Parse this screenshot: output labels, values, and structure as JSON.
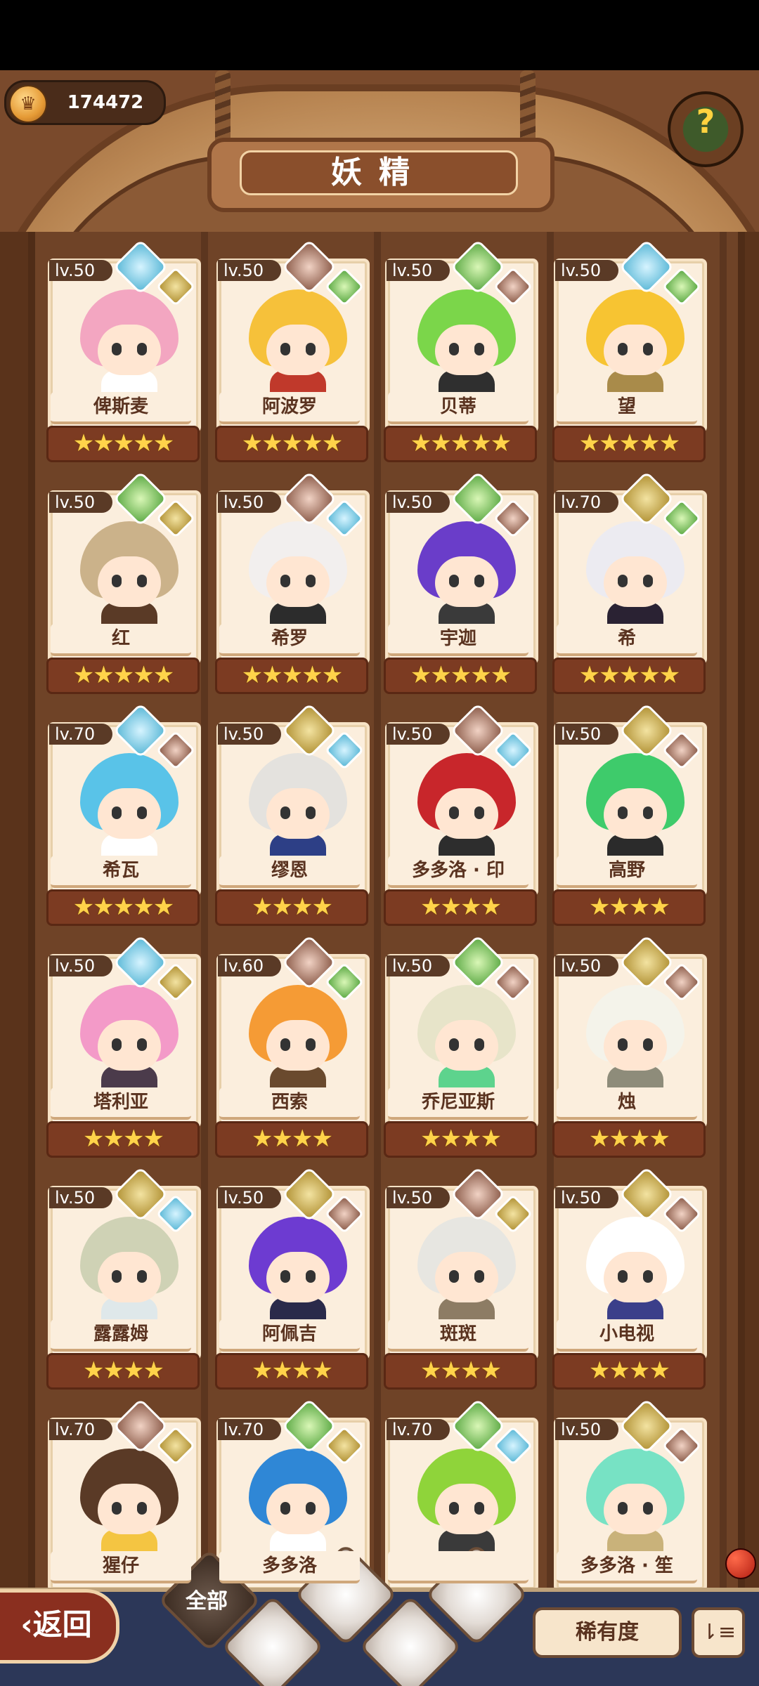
{
  "header": {
    "currency_value": "174472",
    "title": "妖精",
    "currency_icon": "coin-icon",
    "help_icon": "question-icon"
  },
  "cards": [
    {
      "level": "lv.50",
      "name": "俾斯麦",
      "stars": "★★★★★",
      "elements": [
        "water",
        "earth"
      ],
      "hair": "#f3a6c1",
      "outfit": "#ffffff"
    },
    {
      "level": "lv.50",
      "name": "阿波罗",
      "stars": "★★★★★",
      "elements": [
        "rock",
        "plant"
      ],
      "hair": "#f6c13a",
      "outfit": "#c0392b"
    },
    {
      "level": "lv.50",
      "name": "贝蒂",
      "stars": "★★★★★",
      "elements": [
        "plant",
        "rock"
      ],
      "hair": "#7bd64a",
      "outfit": "#2f2f2f"
    },
    {
      "level": "lv.50",
      "name": "望",
      "stars": "★★★★★",
      "elements": [
        "water",
        "plant"
      ],
      "hair": "#f7c432",
      "outfit": "#a98b4a"
    },
    {
      "level": "lv.50",
      "name": "红",
      "stars": "★★★★★",
      "elements": [
        "plant",
        "earth"
      ],
      "hair": "#cbb28a",
      "outfit": "#5a3a26"
    },
    {
      "level": "lv.50",
      "name": "希罗",
      "stars": "★★★★★",
      "elements": [
        "rock",
        "water"
      ],
      "hair": "#f2efee",
      "outfit": "#2c2c2c"
    },
    {
      "level": "lv.50",
      "name": "宇迦",
      "stars": "★★★★★",
      "elements": [
        "plant",
        "rock"
      ],
      "hair": "#6a3dc9",
      "outfit": "#3a3a3a"
    },
    {
      "level": "lv.70",
      "name": "希",
      "stars": "★★★★★",
      "elements": [
        "earth",
        "plant"
      ],
      "hair": "#ecebf1",
      "outfit": "#2a2233"
    },
    {
      "level": "lv.70",
      "name": "希瓦",
      "stars": "★★★★★",
      "elements": [
        "water",
        "rock"
      ],
      "hair": "#59c3e8",
      "outfit": "#ffffff"
    },
    {
      "level": "lv.50",
      "name": "缪恩",
      "stars": "★★★★",
      "elements": [
        "earth",
        "water"
      ],
      "hair": "#e4e2de",
      "outfit": "#2d3f86"
    },
    {
      "level": "lv.50",
      "name": "多多洛 · 印",
      "stars": "★★★★",
      "elements": [
        "rock",
        "water"
      ],
      "hair": "#c8262b",
      "outfit": "#2d2d2d"
    },
    {
      "level": "lv.50",
      "name": "高野",
      "stars": "★★★★",
      "elements": [
        "earth",
        "rock"
      ],
      "hair": "#3ecb6b",
      "outfit": "#2b2b2b"
    },
    {
      "level": "lv.50",
      "name": "塔利亚",
      "stars": "★★★★",
      "elements": [
        "water",
        "earth"
      ],
      "hair": "#f39ac8",
      "outfit": "#4b3b4b"
    },
    {
      "level": "lv.60",
      "name": "西索",
      "stars": "★★★★",
      "elements": [
        "rock",
        "plant"
      ],
      "hair": "#f59b35",
      "outfit": "#6a4a2e"
    },
    {
      "level": "lv.50",
      "name": "乔尼亚斯",
      "stars": "★★★★",
      "elements": [
        "plant",
        "rock"
      ],
      "hair": "#e7e4c9",
      "outfit": "#5dd38d"
    },
    {
      "level": "lv.50",
      "name": "烛",
      "stars": "★★★★",
      "elements": [
        "earth",
        "rock"
      ],
      "hair": "#f4f3ea",
      "outfit": "#8e8c7a"
    },
    {
      "level": "lv.50",
      "name": "露露姆",
      "stars": "★★★★",
      "elements": [
        "earth",
        "water"
      ],
      "hair": "#cfd2b5",
      "outfit": "#dfe8ea"
    },
    {
      "level": "lv.50",
      "name": "阿佩吉",
      "stars": "★★★★",
      "elements": [
        "earth",
        "rock"
      ],
      "hair": "#6d3bd1",
      "outfit": "#2a2a4a"
    },
    {
      "level": "lv.50",
      "name": "斑斑",
      "stars": "★★★★",
      "elements": [
        "rock",
        "earth"
      ],
      "hair": "#e7e6e1",
      "outfit": "#8d7c64"
    },
    {
      "level": "lv.50",
      "name": "小电视",
      "stars": "★★★★",
      "elements": [
        "earth",
        "rock"
      ],
      "hair": "#ffffff",
      "outfit": "#3b3f8a"
    },
    {
      "level": "lv.70",
      "name": "猩仔",
      "stars": "",
      "elements": [
        "rock",
        "earth"
      ],
      "hair": "#5a3a26",
      "outfit": "#f4c542"
    },
    {
      "level": "lv.70",
      "name": "多多洛",
      "stars": "",
      "elements": [
        "plant",
        "earth"
      ],
      "hair": "#2f87d6",
      "outfit": "#ffffff"
    },
    {
      "level": "lv.70",
      "name": "",
      "stars": "",
      "elements": [
        "plant",
        "water"
      ],
      "hair": "#8fd43a",
      "outfit": "#3a3a3a"
    },
    {
      "level": "lv.50",
      "name": "多多洛 · 笙",
      "stars": "",
      "elements": [
        "earth",
        "rock"
      ],
      "hair": "#77e2c4",
      "outfit": "#c9b27a"
    }
  ],
  "bottom": {
    "back_label": "返回",
    "filter_all_label": "全部",
    "rarity_label": "稀有度",
    "sort_icon": "sort-icon"
  }
}
